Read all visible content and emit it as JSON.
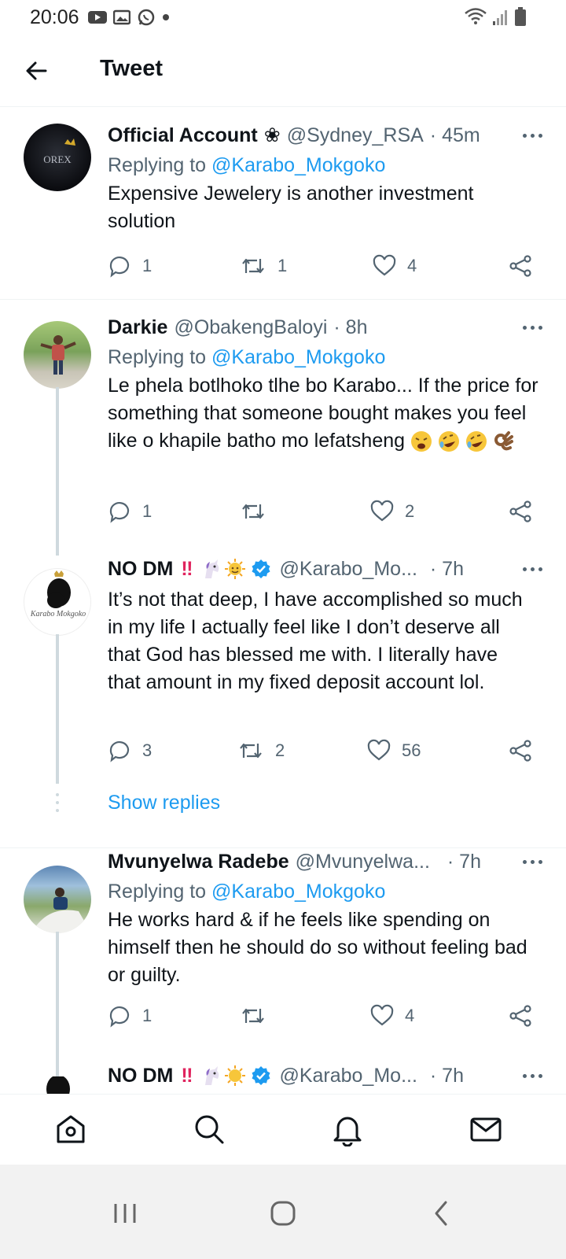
{
  "status_bar": {
    "time": "20:06"
  },
  "header": {
    "title": "Tweet"
  },
  "tweets": [
    {
      "display_name": "Official Account",
      "name_glyph": "❀",
      "handle": "@Sydney_RSA",
      "time": "· 45m",
      "replying_prefix": "Replying to",
      "replying_to": "@Karabo_Mokgoko",
      "text": "Expensive Jewelery is another investment solution",
      "replies": "1",
      "retweets": "1",
      "likes": "4",
      "avatar_text": "OREX"
    },
    {
      "display_name": "Darkie",
      "handle": "@ObakengBaloyi",
      "time": "· 8h",
      "replying_prefix": "Replying to",
      "replying_to": "@Karabo_Mokgoko",
      "text": "Le phela botlhoko tlhe bo Karabo... If the price for something that someone bought makes you feel like o khapile batho mo lefatsheng",
      "replies": "1",
      "retweets": "",
      "likes": "2"
    },
    {
      "display_name": "NO DM",
      "name_glyph": "‼",
      "handle": "@Karabo_Mo...",
      "time": "· 7h",
      "text": "It’s not that deep, I have accomplished so much in my life I actually feel like I don’t deserve all that God has blessed me with. I literally have that amount in my fixed deposit account lol.",
      "replies": "3",
      "retweets": "2",
      "likes": "56",
      "avatar_text": "Karabo Mokgoko"
    },
    {
      "display_name": "Mvunyelwa Radebe",
      "handle": "@Mvunyelwa...",
      "time": "· 7h",
      "replying_prefix": "Replying to",
      "replying_to": "@Karabo_Mokgoko",
      "text": "He works hard & if he feels like spending on himself then he should do so without feeling bad or guilty.",
      "replies": "1",
      "retweets": "",
      "likes": "4"
    },
    {
      "display_name": "NO DM",
      "name_glyph": "‼",
      "handle": "@Karabo_Mo...",
      "time": "· 7h"
    }
  ],
  "show_replies_label": "Show replies",
  "bottom_nav": [
    "home-icon",
    "search-icon",
    "notifications-icon",
    "messages-icon"
  ],
  "colors": {
    "accent": "#1d9bf0",
    "text": "#0f1419",
    "muted": "#536471",
    "thread_line": "#cfd9de"
  }
}
